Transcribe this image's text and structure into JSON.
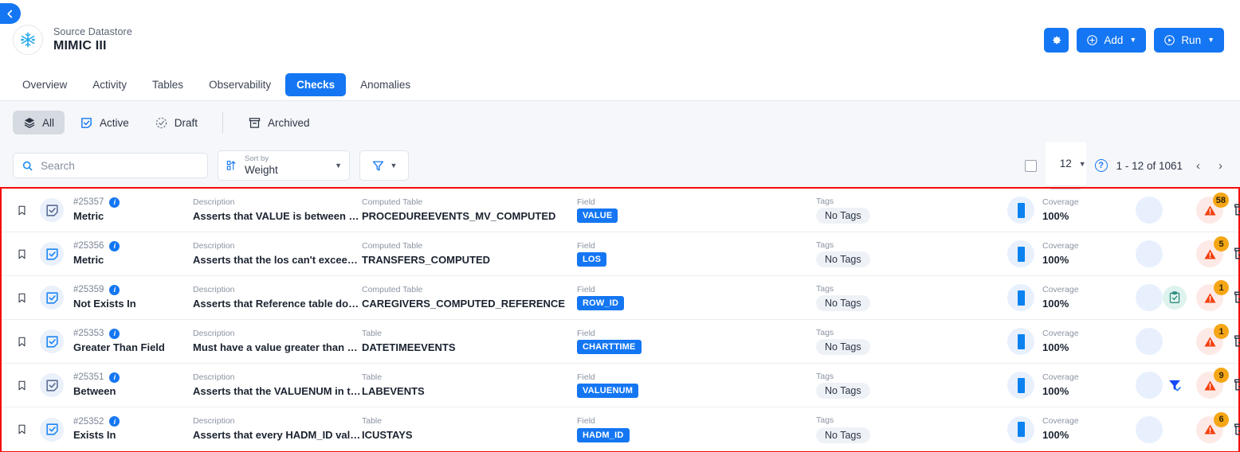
{
  "back_button": {
    "icon": "chevron-left-icon"
  },
  "header": {
    "logo_icon": "snowflake-icon",
    "source_label": "Source Datastore",
    "datastore_name": "MIMIC III",
    "actions": {
      "settings_icon": "gear-icon",
      "add_label": "Add",
      "add_icon": "plus-circle-icon",
      "run_label": "Run",
      "run_icon": "play-circle-icon",
      "chevron_icon": "chevron-down-icon"
    }
  },
  "tabs": [
    {
      "label": "Overview",
      "active": false
    },
    {
      "label": "Activity",
      "active": false
    },
    {
      "label": "Tables",
      "active": false
    },
    {
      "label": "Observability",
      "active": false
    },
    {
      "label": "Checks",
      "active": true
    },
    {
      "label": "Anomalies",
      "active": false
    }
  ],
  "filter_tabs": [
    {
      "label": "All",
      "icon": "layers-icon",
      "selected": true
    },
    {
      "label": "Active",
      "icon": "checkbox-checked-icon",
      "selected": false
    },
    {
      "label": "Draft",
      "icon": "dashed-circle-check-icon",
      "selected": false
    },
    {
      "label": "Archived",
      "icon": "archive-box-icon",
      "selected": false
    }
  ],
  "toolbar": {
    "search_placeholder": "Search",
    "search_value": "",
    "search_icon": "search-icon",
    "sort_label": "Sort by",
    "sort_value": "Weight",
    "sort_icon": "sort-icon",
    "filter_icon": "funnel-icon"
  },
  "pagination": {
    "select_all_checkbox": "checkbox-unchecked-icon",
    "page_size": "12",
    "help_icon": "help-circle-icon",
    "range_text": "1 - 12 of 1061",
    "prev_icon": "chevron-left-icon",
    "next_icon": "chevron-right-icon"
  },
  "column_labels": {
    "description": "Description",
    "computed_table": "Computed Table",
    "table": "Table",
    "field": "Field",
    "tags": "Tags",
    "coverage": "Coverage"
  },
  "rows": [
    {
      "bookmark_icon": "bookmark-icon",
      "check_icon": "check-square-icon",
      "check_style": "slate",
      "id": "#25357",
      "info_icon": "info-icon",
      "type": "Metric",
      "description_label": "Description",
      "description": "Asserts that VALUE is between MI...",
      "table_label": "Computed Table",
      "table": "PROCEDUREEVENTS_MV_COMPUTED",
      "field_label": "Field",
      "field": "VALUE",
      "tags_label": "Tags",
      "tags": "No Tags",
      "coverage_label": "Coverage",
      "coverage": "100%",
      "extra_icon": "",
      "warning_icon": "warning-triangle-icon",
      "warning_count": "58",
      "archive_icon": "archive-download-icon"
    },
    {
      "bookmark_icon": "bookmark-icon",
      "check_icon": "check-square-icon",
      "check_style": "blue",
      "id": "#25356",
      "info_icon": "info-icon",
      "type": "Metric",
      "description_label": "Description",
      "description": "Asserts that the los can't exceed t...",
      "table_label": "Computed Table",
      "table": "TRANSFERS_COMPUTED",
      "field_label": "Field",
      "field": "LOS",
      "tags_label": "Tags",
      "tags": "No Tags",
      "coverage_label": "Coverage",
      "coverage": "100%",
      "extra_icon": "",
      "warning_icon": "warning-triangle-icon",
      "warning_count": "5",
      "archive_icon": "archive-download-icon"
    },
    {
      "bookmark_icon": "bookmark-icon",
      "check_icon": "check-square-icon",
      "check_style": "blue",
      "id": "#25359",
      "info_icon": "info-icon",
      "type": "Not Exists In",
      "description_label": "Description",
      "description": "Asserts that Reference table does ...",
      "table_label": "Computed Table",
      "table": "CAREGIVERS_COMPUTED_REFERENCE",
      "field_label": "Field",
      "field": "ROW_ID",
      "tags_label": "Tags",
      "tags": "No Tags",
      "coverage_label": "Coverage",
      "coverage": "100%",
      "extra_icon": "clipboard-check-icon",
      "warning_icon": "warning-triangle-icon",
      "warning_count": "1",
      "archive_icon": "archive-download-icon"
    },
    {
      "bookmark_icon": "bookmark-icon",
      "check_icon": "check-square-icon",
      "check_style": "blue",
      "id": "#25353",
      "info_icon": "info-icon",
      "type": "Greater Than Field",
      "description_label": "Description",
      "description": "Must have a value greater than or ...",
      "table_label": "Table",
      "table": "DATETIMEEVENTS",
      "field_label": "Field",
      "field": "CHARTTIME",
      "tags_label": "Tags",
      "tags": "No Tags",
      "coverage_label": "Coverage",
      "coverage": "100%",
      "extra_icon": "",
      "warning_icon": "warning-triangle-icon",
      "warning_count": "1",
      "archive_icon": "archive-download-icon"
    },
    {
      "bookmark_icon": "bookmark-icon",
      "check_icon": "check-square-icon",
      "check_style": "slate",
      "id": "#25351",
      "info_icon": "info-icon",
      "type": "Between",
      "description_label": "Description",
      "description": "Asserts that the VALUENUM in the ...",
      "table_label": "Table",
      "table": "LABEVENTS",
      "field_label": "Field",
      "field": "VALUENUM",
      "tags_label": "Tags",
      "tags": "No Tags",
      "coverage_label": "Coverage",
      "coverage": "100%",
      "extra_icon": "funnel-check-icon",
      "warning_icon": "warning-triangle-icon",
      "warning_count": "9",
      "archive_icon": "archive-download-icon"
    },
    {
      "bookmark_icon": "bookmark-icon",
      "check_icon": "check-square-icon",
      "check_style": "blue",
      "id": "#25352",
      "info_icon": "info-icon",
      "type": "Exists In",
      "description_label": "Description",
      "description": "Asserts that every HADM_ID value ...",
      "table_label": "Table",
      "table": "ICUSTAYS",
      "field_label": "Field",
      "field": "HADM_ID",
      "tags_label": "Tags",
      "tags": "No Tags",
      "coverage_label": "Coverage",
      "coverage": "100%",
      "extra_icon": "",
      "warning_icon": "warning-triangle-icon",
      "warning_count": "6",
      "archive_icon": "archive-download-icon"
    }
  ],
  "colors": {
    "accent": "#1476f2",
    "badge_field": "#1476f2",
    "warning": "#f4400f",
    "count_badge": "#f5a615",
    "highlight_border": "#f50b0b",
    "toolbar_bg": "#f5f7fa"
  }
}
